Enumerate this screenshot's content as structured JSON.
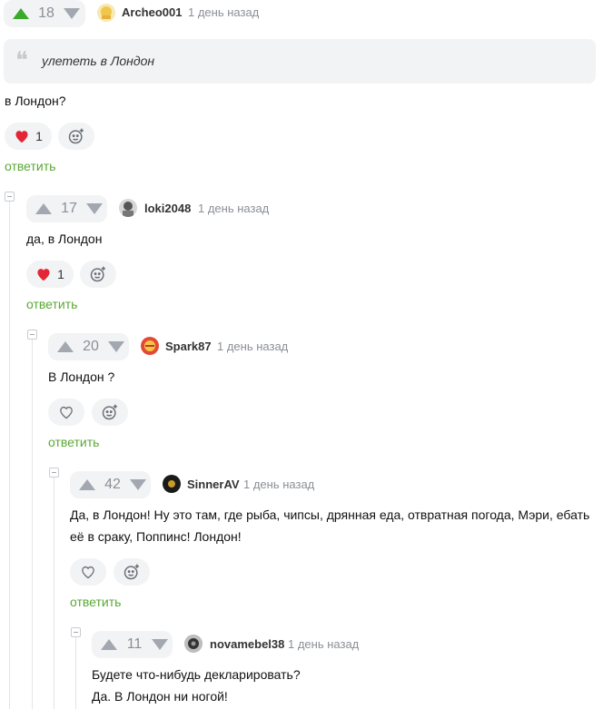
{
  "comments": [
    {
      "score": "18",
      "author": "Archeo001",
      "time": "1 день назад",
      "quote": "улететь в Лондон",
      "text": "в Лондон?",
      "likes": "1",
      "reply": "ответить"
    },
    {
      "score": "17",
      "author": "loki2048",
      "time": "1 день назад",
      "text": "да, в Лондон",
      "likes": "1",
      "reply": "ответить"
    },
    {
      "score": "20",
      "author": "Spark87",
      "time": "1 день назад",
      "text": "В Лондон ?",
      "reply": "ответить"
    },
    {
      "score": "42",
      "author": "SinnerAV",
      "time": "1 день назад",
      "text_line1": "Да, в Лондон! Ну это там, где рыба, чипсы, дрянная еда, отвратная погода, Мэри, ебать",
      "text_line2": "её в сраку, Поппинс! Лондон!",
      "reply": "ответить"
    },
    {
      "score": "11",
      "author": "novamebel38",
      "time": "1 день назад",
      "text_line1": "Будете что-нибудь декларировать?",
      "text_line2": "Да. В Лондон ни ногой!"
    }
  ],
  "colors": {
    "upvote_active": "#3ba92a",
    "reply_link": "#5aa834",
    "heart": "#e32636"
  },
  "icons": [
    "upvote-icon",
    "downvote-icon",
    "heart-icon",
    "add-reaction-icon",
    "quote-icon",
    "collapse-icon"
  ]
}
